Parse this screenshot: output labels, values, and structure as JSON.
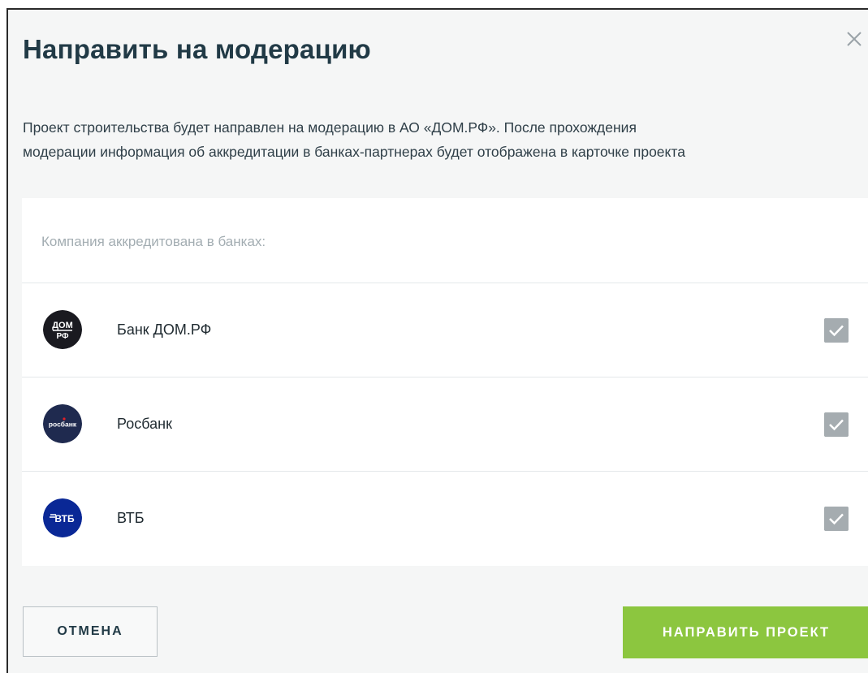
{
  "modal": {
    "title": "Направить на модерацию",
    "close_icon": "close-icon",
    "description_line1": "Проект строительства будет направлен на модерацию в АО «ДОМ.РФ». После прохождения",
    "description_line2": "модерации информация об аккредитации в банках-партнерах будет отображена в карточке проекта"
  },
  "banks": {
    "header": "Компания аккредитована в банках:",
    "items": [
      {
        "name": "Банк ДОМ.РФ",
        "logo_text_top": "ДОМ",
        "logo_text_bottom": "РФ",
        "logo_color": "#1a1a20",
        "checked": true
      },
      {
        "name": "Росбанк",
        "logo_text": "росбанк",
        "logo_color": "#1f2a4f",
        "checked": true
      },
      {
        "name": "ВТБ",
        "logo_text": "ВТБ",
        "logo_color": "#0a2896",
        "checked": true
      }
    ]
  },
  "footer": {
    "cancel_label": "ОТМЕНА",
    "submit_label": "НАПРАВИТЬ ПРОЕКТ"
  },
  "colors": {
    "title": "#213a46",
    "accent_green": "#8cc63f",
    "checkbox": "#a5acb0",
    "background": "#f5f6f6"
  }
}
